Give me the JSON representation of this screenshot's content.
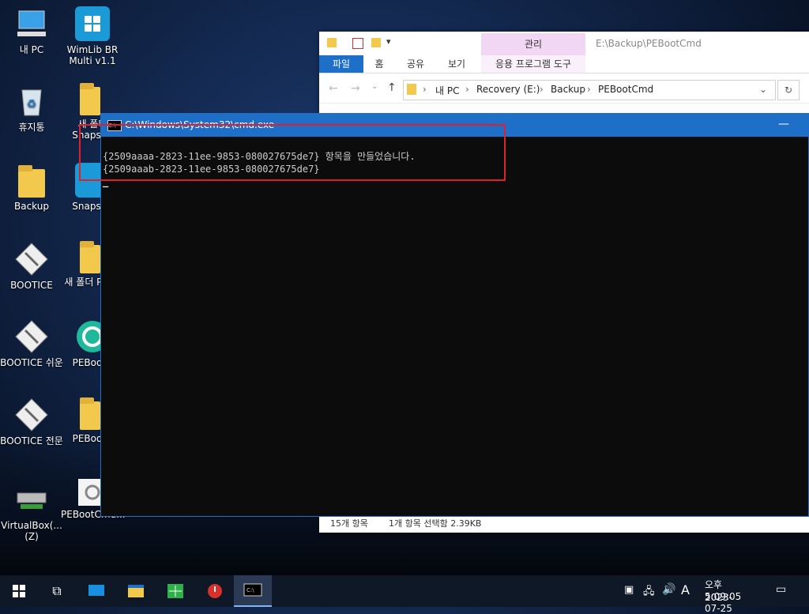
{
  "desktop": {
    "icons": [
      {
        "label": "내 PC",
        "icon": "computer-icon"
      },
      {
        "label": "WimLib BR Multi v1.1",
        "icon": "windows-logo-icon"
      },
      {
        "label": "휴지통",
        "icon": "recycle-bin-icon"
      },
      {
        "label": "새 폴더 Snapsho",
        "icon": "folder-icon"
      },
      {
        "label": "Backup",
        "icon": "folder-icon"
      },
      {
        "label": "Snapsho",
        "icon": "windows-logo-icon"
      },
      {
        "label": "BOOTICE",
        "icon": "bootice-icon"
      },
      {
        "label": "새 폴더 PEBo",
        "icon": "folder-icon"
      },
      {
        "label": "BOOTICE 쉬운",
        "icon": "bootice-icon"
      },
      {
        "label": "PEBootC",
        "icon": "pebootcmd-icon"
      },
      {
        "label": "BOOTICE 전문",
        "icon": "bootice-icon"
      },
      {
        "label": "PEBootC",
        "icon": "folder-icon"
      },
      {
        "label": "VirtualBox(... (Z)",
        "icon": "network-drive-icon"
      },
      {
        "label": "PEBootCmd...",
        "icon": "settings-file-icon"
      }
    ]
  },
  "explorer": {
    "context_tab": "관리",
    "path_title": "E:\\Backup\\PEBootCmd",
    "tabs": [
      "파일",
      "홈",
      "공유",
      "보기",
      "응용 프로그램 도구"
    ],
    "breadcrumb": [
      "내 PC",
      "Recovery (E:)",
      "Backup",
      "PEBootCmd"
    ],
    "status_items": "15개 항목",
    "status_selected": "1개 항목 선택함 2.39KB"
  },
  "cmd": {
    "title": "C:\\Windows\\System32\\cmd.exe",
    "lines": [
      "{2509aaaa-2823-11ee-9853-080027675de7} 항목을 만들었습니다.",
      "{2509aaab-2823-11ee-9853-080027675de7}"
    ],
    "cursor": "_"
  },
  "taskbar": {
    "time": "오후 5:09:05",
    "date": "2023-07-25",
    "ime": "A"
  },
  "colors": {
    "accent": "#1e6fc8",
    "highlight": "#e0202a",
    "context_tab": "#f1d7f3"
  }
}
